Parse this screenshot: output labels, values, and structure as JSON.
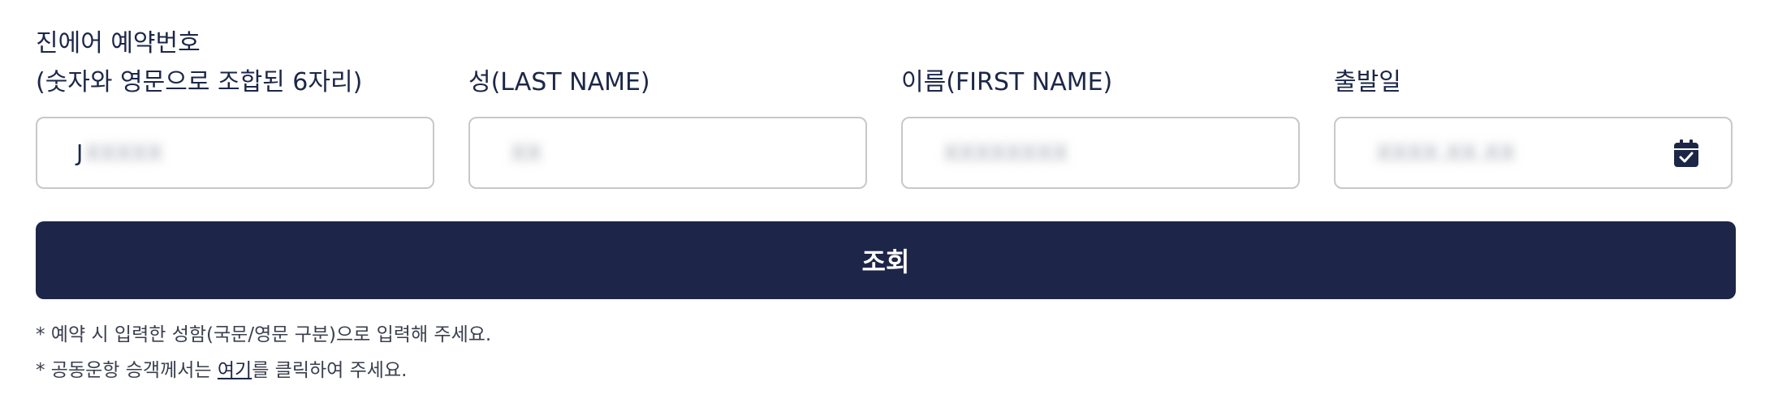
{
  "form": {
    "fields": [
      {
        "label_line1": "진에어 예약번호",
        "label_line2": "(숫자와 영문으로 조합된 6자리)",
        "value_visible": "J",
        "value_obscured": "XXXXX"
      },
      {
        "label_line1": "성(LAST NAME)",
        "value_obscured": "XX"
      },
      {
        "label_line1": "이름(FIRST NAME)",
        "value_obscured": "XXXXXXXX"
      },
      {
        "label_line1": "출발일",
        "value_obscured": "XXXX.XX.XX",
        "icon": "calendar-check-icon"
      }
    ],
    "submit_label": "조회"
  },
  "notes": {
    "note1": "* 예약 시 입력한 성함(국문/영문 구분)으로 입력해 주세요.",
    "note2_prefix": "* 공동운항 승객께서는 ",
    "note2_link": "여기",
    "note2_suffix": "를 클릭하여 주세요."
  },
  "colors": {
    "primary": "#1d2548",
    "text": "#1c2748",
    "border": "#c8c8cc"
  }
}
